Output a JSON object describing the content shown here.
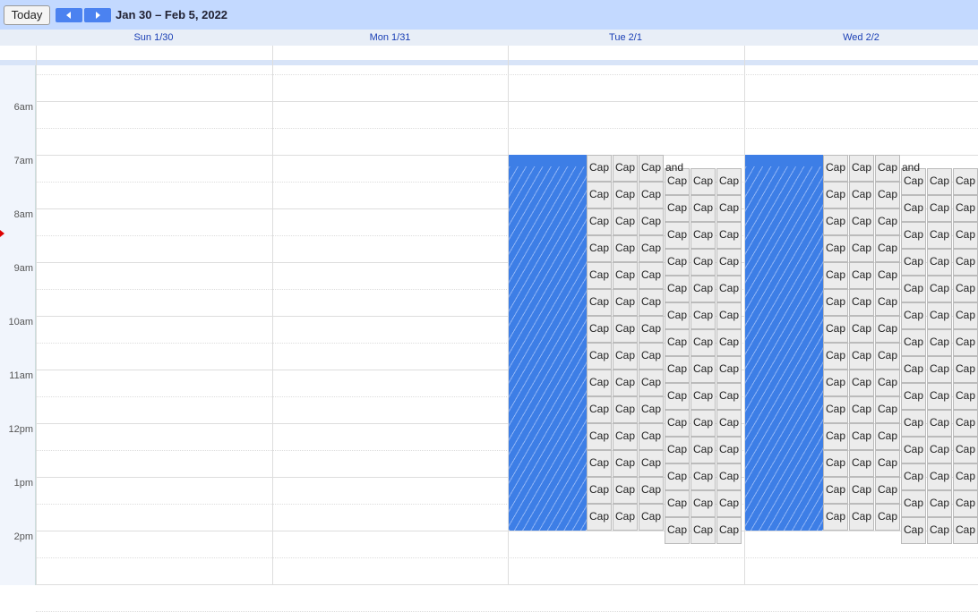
{
  "toolbar": {
    "today_label": "Today",
    "date_range": "Jan 30 – Feb 5, 2022"
  },
  "days": [
    "Sun 1/30",
    "Mon 1/31",
    "Tue 2/1",
    "Wed 2/2"
  ],
  "hours": [
    "6am",
    "7am",
    "8am",
    "9am",
    "10am",
    "11am",
    "12pm",
    "1pm",
    "2pm"
  ],
  "event_label": "Cap",
  "overflow_label": "and",
  "colors": {
    "toolbar": "#c3d9ff",
    "busy": "#3d7ee6",
    "day_text": "#1a3fb5"
  }
}
